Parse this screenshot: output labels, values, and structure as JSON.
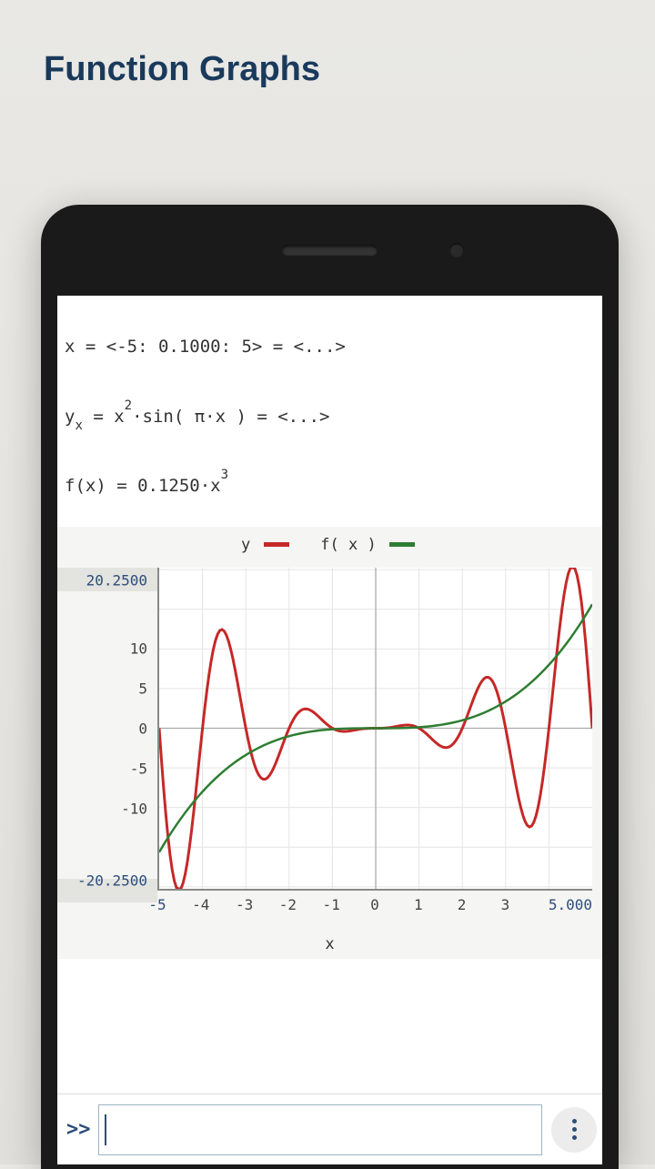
{
  "title": "Function Graphs",
  "expressions": {
    "line1_a": "x = <-5: 0.1000: 5> = <...>",
    "line2_y": "y",
    "line2_sub": "x",
    "line2_eq": " = x",
    "line2_sup": "2",
    "line2_rest": "·sin( π·x ) = <...>",
    "line3_a": "f(x) = 0.1250·x",
    "line3_sup": "3"
  },
  "chart_data": {
    "type": "line",
    "xlabel": "x",
    "legend": {
      "entries": [
        {
          "name": "y",
          "color": "#c62828"
        },
        {
          "name": "f( x )",
          "color": "#2e7d32"
        }
      ]
    },
    "xticks": [
      -5,
      -4,
      -3,
      -2,
      -1,
      0,
      1,
      2,
      3,
      "5.000"
    ],
    "yticks_edge_top": "20.2500",
    "yticks_edge_bottom": "-20.2500",
    "yticks": [
      10,
      5,
      0,
      -5,
      -10
    ],
    "xlim": [
      -5,
      5
    ],
    "ylim": [
      -20.25,
      20.25
    ],
    "x": [
      -5,
      -4.5,
      -4,
      -3.5,
      -3,
      -2.5,
      -2,
      -1.5,
      -1,
      -0.5,
      0,
      0.5,
      1,
      1.5,
      2,
      2.5,
      3,
      3.5,
      4,
      4.5,
      5
    ],
    "series": [
      {
        "name": "y",
        "expr": "x^2 * sin(pi*x)",
        "values": [
          0,
          -20.25,
          0,
          12.25,
          0,
          -6.25,
          0,
          2.25,
          0,
          -0.25,
          0,
          0.25,
          0,
          -2.25,
          0,
          6.25,
          0,
          -12.25,
          0,
          20.25,
          0
        ]
      },
      {
        "name": "f(x)",
        "expr": "0.125*x^3",
        "values": [
          -15.625,
          -11.39,
          -8,
          -5.359,
          -3.375,
          -1.953,
          -1,
          -0.422,
          -0.125,
          -0.0156,
          0,
          0.0156,
          0.125,
          0.422,
          1,
          1.953,
          3.375,
          5.359,
          8,
          11.39,
          15.625
        ]
      }
    ]
  },
  "input": {
    "prompt": ">>",
    "value": ""
  }
}
